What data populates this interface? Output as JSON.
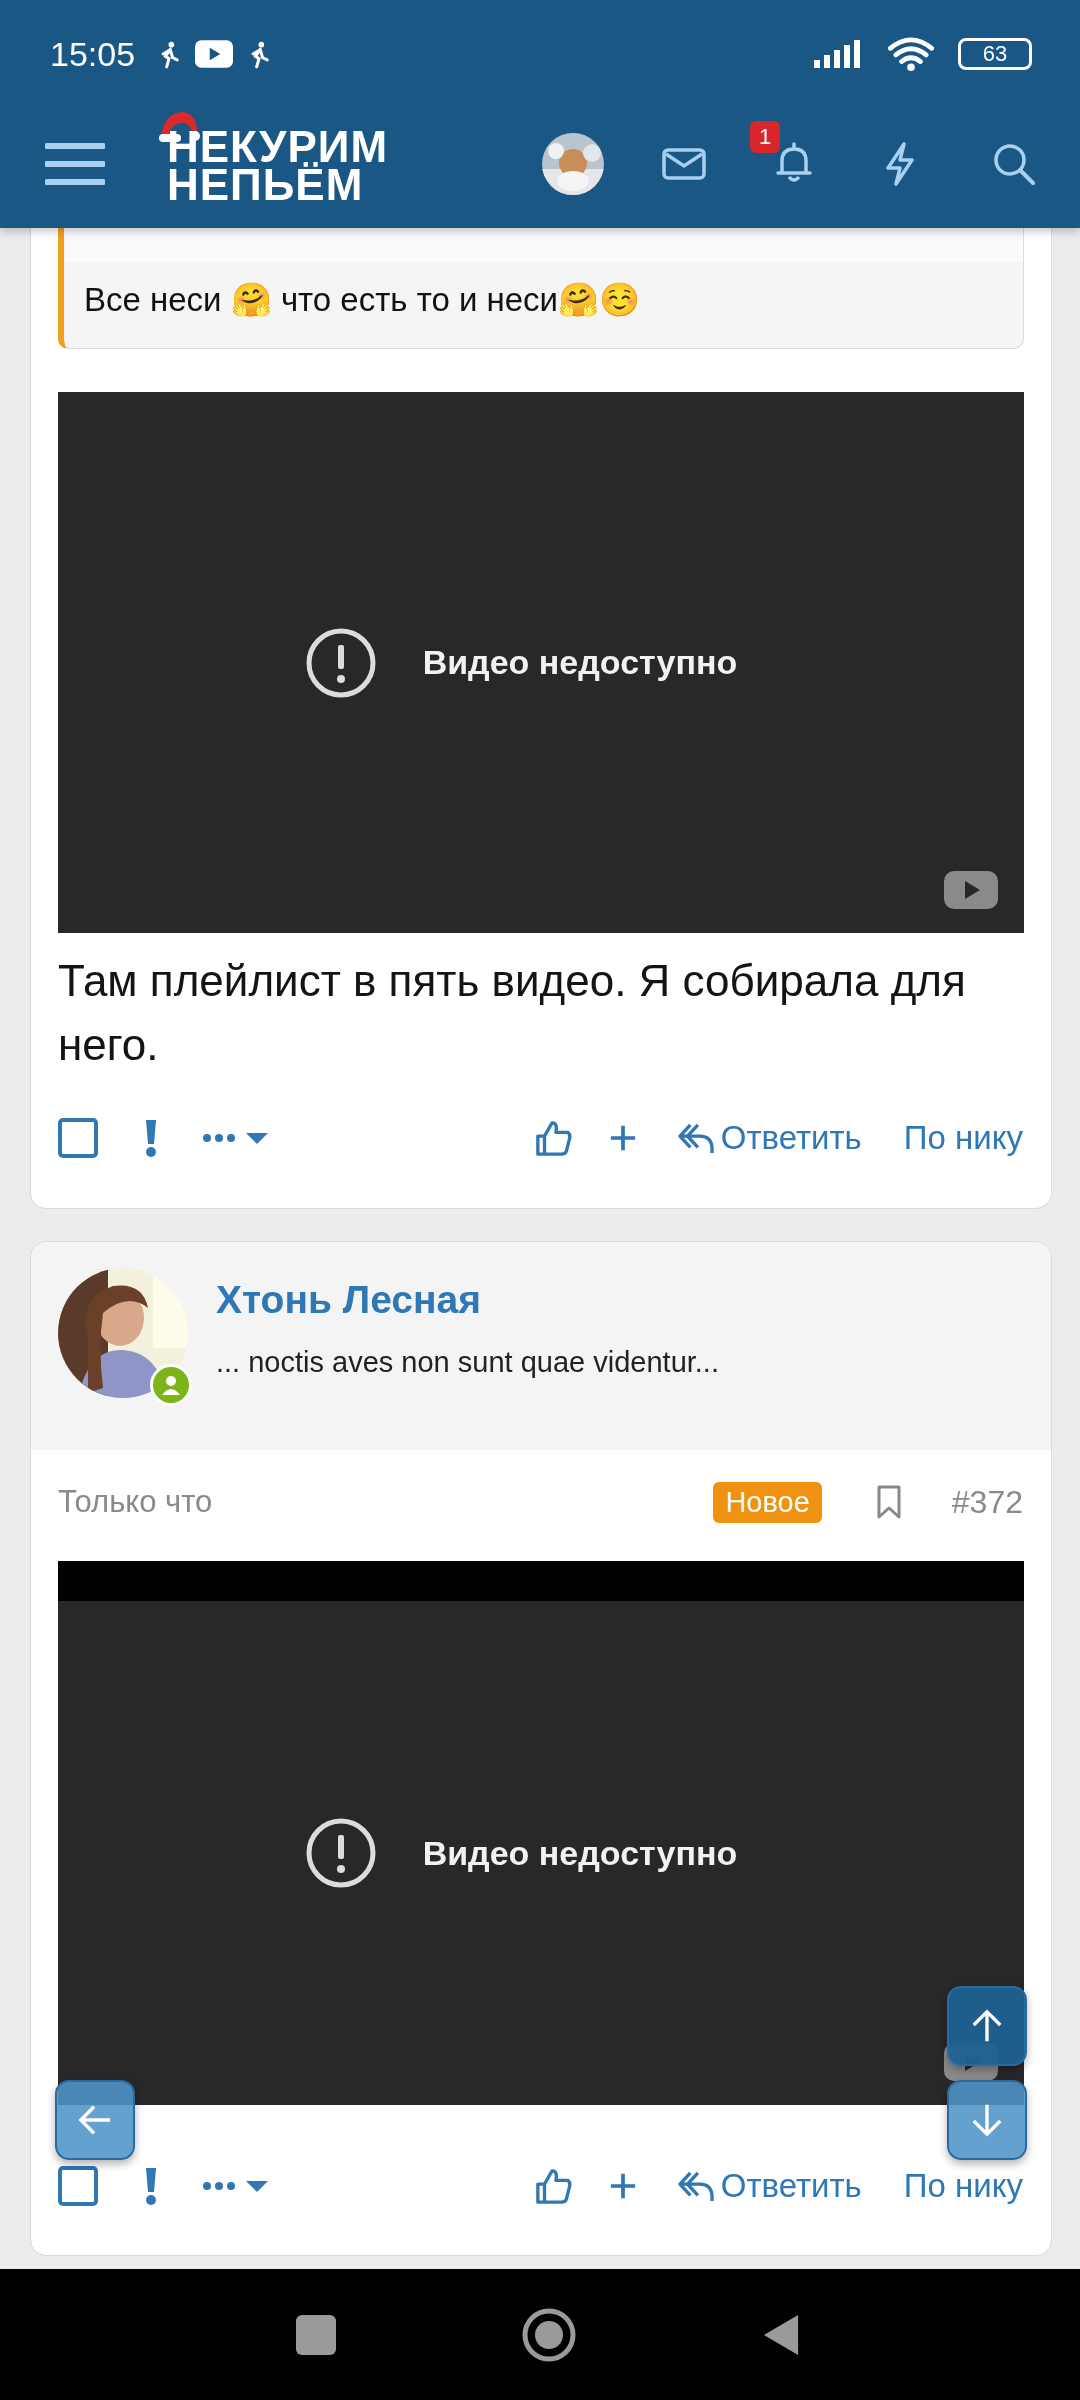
{
  "status_bar": {
    "time": "15:05",
    "battery": "63"
  },
  "header": {
    "logo_lines": [
      "НЕКУРИМ",
      "НЕПЬЁМ"
    ],
    "notification_badge": "1"
  },
  "posts": [
    {
      "quote": {
        "text": "Все неси 🤗 что есть то и неси🤗☺️"
      },
      "video": {
        "message": "Видео недоступно",
        "top_bar": false
      },
      "body": "Там плейлист в пять видео. Я собирала для него.",
      "actions": {
        "checked": false,
        "reply": "Ответить",
        "by_nick": "По нику"
      }
    },
    {
      "author": {
        "name": "Хтонь Лесная",
        "status": "... noctis aves non sunt quae videntur...",
        "online": true
      },
      "meta": {
        "time": "Только что",
        "badge": "Новое",
        "number": "#372"
      },
      "video": {
        "message": "Видео недоступно",
        "top_bar": true
      },
      "actions": {
        "checked": false,
        "reply": "Ответить",
        "by_nick": "По нику"
      }
    }
  ]
}
